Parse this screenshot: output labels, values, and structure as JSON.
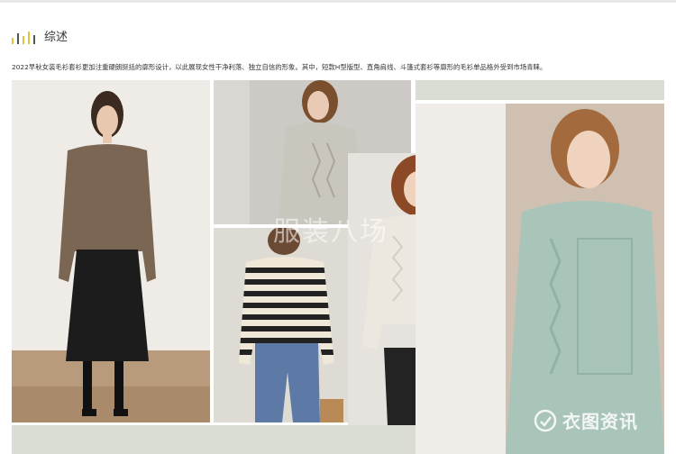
{
  "section": {
    "title": "综述",
    "bar_colors": [
      "#e0c53c",
      "#555555",
      "#e0c53c",
      "#e0c53c",
      "#555555"
    ],
    "bar_levels": [
      0.5,
      0.85,
      0.65,
      1.0,
      0.7
    ]
  },
  "intro_text": "2022早秋女装毛衫套衫更加注重硬朗挺括的廓形设计，以此展现女性干净利落、独立自信的形象。其中，短款H型版型、直角肩线、斗篷式套衫等廓形的毛衫单品格外受到市场青睐。",
  "watermark_text": "服装八场",
  "badge_text": "衣图资讯",
  "colors": {
    "band": "#d9ddd4",
    "brown_sweater": "#7a6652",
    "black_skirt": "#1c1c1c",
    "grey_sweater": "#c9c6bd",
    "stripe_dark": "#222222",
    "stripe_light": "#efe7d8",
    "jeans": "#5d7aa6",
    "cream_sweater": "#ece8df",
    "mint_sweater": "#a9c4b8"
  }
}
